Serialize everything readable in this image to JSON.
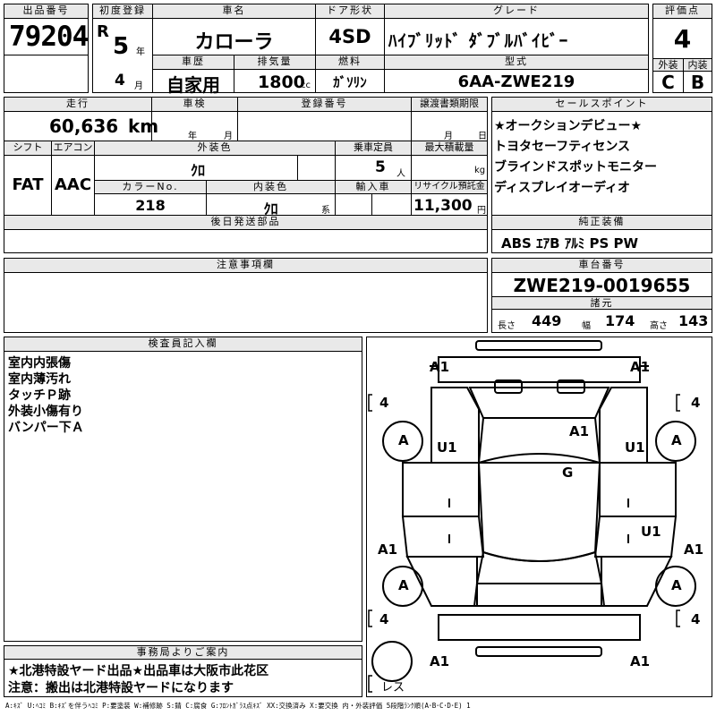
{
  "header": {
    "lot_label": "出品番号",
    "lot_number": "79204",
    "first_reg_label": "初度登録",
    "era": "R",
    "year": "5",
    "year_unit": "年",
    "month": "4",
    "month_unit": "月",
    "car_name_label": "車名",
    "car_name": "カローラ",
    "door_label": "ドア形状",
    "door": "4SD",
    "grade_label": "グレード",
    "grade": "ﾊｲﾌﾞﾘｯﾄﾞ ﾀﾞﾌﾞﾙﾊﾞｲﾋﾞｰ",
    "score_label": "評価点",
    "score": "4",
    "history_label": "車歴",
    "history": "自家用",
    "displacement_label": "排気量",
    "displacement": "1800",
    "displacement_unit": "cc",
    "fuel_label": "燃料",
    "fuel": "ｶﾞｿﾘﾝ",
    "model_label": "型式",
    "model": "6AA-ZWE219",
    "exterior_label": "外装",
    "exterior": "C",
    "interior_label": "内装",
    "interior": "B"
  },
  "info": {
    "mileage_label": "走行",
    "mileage": "60,636",
    "mileage_unit": "km",
    "inspection_label": "車検",
    "year_unit": "年",
    "month_unit": "月",
    "reg_label": "登録番号",
    "transfer_label": "譲渡書類期限",
    "day_unit": "日",
    "shift_label": "シフト",
    "shift": "FAT",
    "ac_label": "エアコン",
    "ac": "AAC",
    "color_label": "外装色",
    "color": "ｸﾛ",
    "capacity_label": "乗車定員",
    "capacity": "5",
    "capacity_unit": "人",
    "load_label": "最大積載量",
    "load_unit": "kg",
    "color_no_label": "カラーNo.",
    "color_no": "218",
    "int_color_label": "内装色",
    "int_color": "ｸﾛ",
    "int_color_suffix": "系",
    "import_label": "輸入車",
    "recycle_label": "リサイクル預託金",
    "recycle": "11,300",
    "recycle_unit": "円",
    "later_label": "後日発送部品",
    "notes_label": "注意事項欄"
  },
  "sales": {
    "label": "セールスポイント",
    "points": [
      "★オークションデビュー★",
      "トヨタセーフティセンス",
      "ブラインドスポットモニター",
      "ディスプレイオーディオ"
    ],
    "equip_label": "純正装備",
    "equipment": "ABS ｴｱB ｱﾙﾐ PS PW",
    "chassis_label": "車台番号",
    "chassis": "ZWE219-0019655",
    "dims_label": "諸元",
    "length_label": "長さ",
    "length": "449",
    "width_label": "幅",
    "width": "174",
    "height_label": "高さ",
    "height": "143"
  },
  "inspector": {
    "label": "検査員記入欄",
    "lines": [
      "室内内張傷",
      "室内薄汚れ",
      "タッチＰ跡",
      "外装小傷有り",
      "バンパー下Ａ"
    ]
  },
  "office": {
    "label": "事務局よりご案内",
    "lines": [
      "★北港特設ヤード出品★出品車は大阪市此花区",
      "注意：搬出は北港特設ヤードになります"
    ]
  },
  "diagram": {
    "marks": {
      "front_left": "A1",
      "front_right": "A1",
      "door_fl": "U1",
      "door_fr": "U1",
      "hood": "A1",
      "roof": "G",
      "door_rr": "U1",
      "rear_left": "A1",
      "rear_right": "A1",
      "back_left": "A1",
      "back_right": "A1",
      "wheel": "A",
      "tire": "4",
      "spare": "レス"
    }
  },
  "legend": "A:ｷｽﾞ U:ﾍｺﾐ B:ｷｽﾞを伴うﾍｺﾐ P:要塗装 W:補修跡 S:錆 C:腐食 G:ﾌﾛﾝﾄｶﾞﾗｽ点ｷｽﾞ XX:交換済み X:要交換  内・外装評価 5段階ﾗﾝｸ順(A･B･C･D･E) 1"
}
